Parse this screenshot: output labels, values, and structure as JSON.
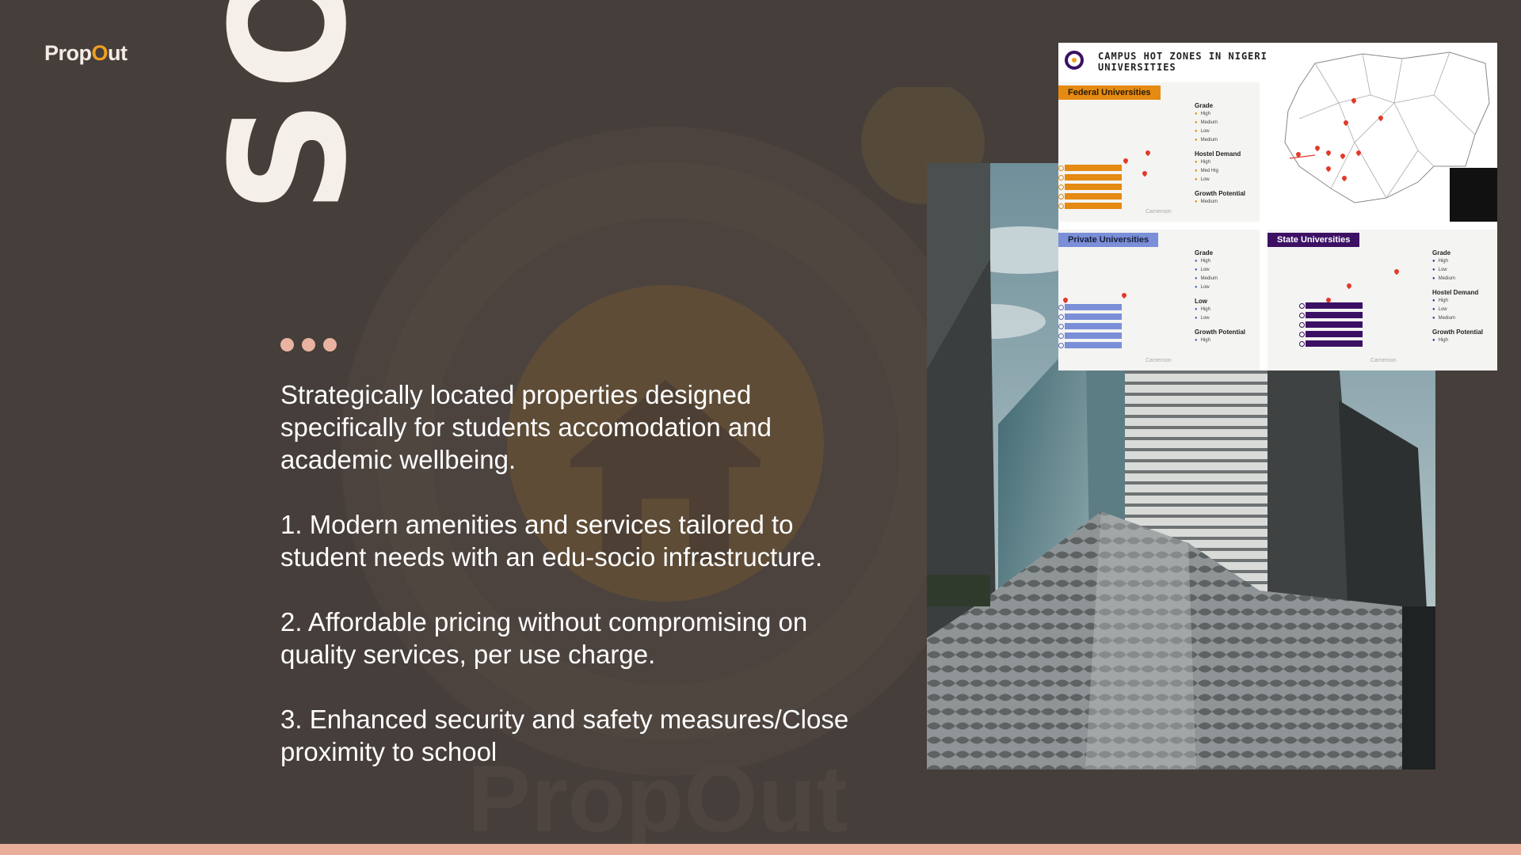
{
  "brand": {
    "logo_text_before": "Prop",
    "logo_text_o": "O",
    "logo_text_after": "ut",
    "watermark_text": "PropOut"
  },
  "title": "SOLUTION",
  "intro": "Strategically located properties designed specifically for students accomodation and academic wellbeing.",
  "points": [
    "1. Modern amenities and services tailored to student needs with an edu-socio infrastructure.",
    "2. Affordable pricing without compromising on quality services, per use charge.",
    "3.  Enhanced security and safety measures/Close proximity to school"
  ],
  "infographic": {
    "title_line1": "CAMPUS HOT ZONES IN NIGERIA",
    "title_line2": "UNIVERSITIES",
    "federal": {
      "label": "Federal Universities",
      "legend": {
        "grade_title": "Grade",
        "grade_rows": [
          "High",
          "Medium",
          "Low",
          "Medium"
        ],
        "hostel_title": "Hostel Demand",
        "hostel_rows": [
          "High",
          "Med Hig",
          "Low"
        ],
        "growth_title": "Growth Potential",
        "growth_rows": [
          "Medium"
        ]
      },
      "map_note": "Cameroon"
    },
    "private": {
      "label": "Private Universities",
      "legend": {
        "grade_title": "Grade",
        "grade_rows": [
          "High",
          "Low",
          "Medium",
          "Low"
        ],
        "low_title": "Low",
        "low_rows": [
          "High",
          "Low"
        ],
        "growth_title": "Growth Potential",
        "growth_rows": [
          "High"
        ]
      },
      "map_note": "Cameroon"
    },
    "state": {
      "label": "State Universities",
      "legend": {
        "grade_title": "Grade",
        "grade_rows": [
          "High",
          "Low",
          "Medium"
        ],
        "hostel_title": "Hostel Demand",
        "hostel_rows": [
          "High",
          "Low",
          "Medium"
        ],
        "growth_title": "Growth Potential",
        "growth_rows": [
          "High"
        ]
      },
      "map_note": "Cameroon"
    }
  },
  "colors": {
    "background": "#463e3a",
    "accent_dots": "#eab3a1",
    "bottom_bar": "#e8ae9a",
    "title_text": "#f4efe8",
    "logo_accent": "#f0a020",
    "federal": "#e58a12",
    "private": "#7a8fd8",
    "state": "#3c1164"
  }
}
